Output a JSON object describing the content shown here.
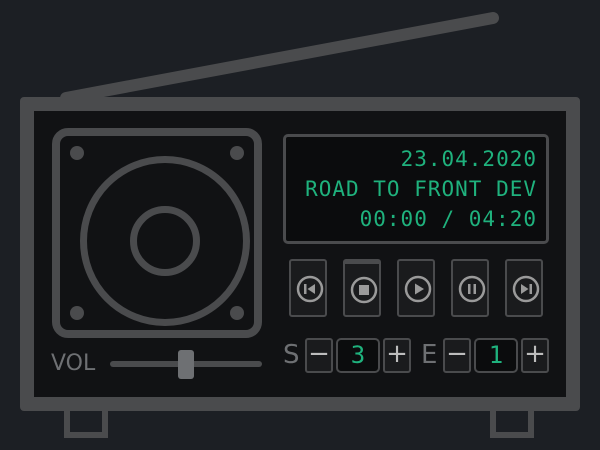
{
  "display": {
    "date": "23.04.2020",
    "track_title": "ROAD TO FRONT DEV",
    "time": "00:00 / 04:20"
  },
  "controls": [
    {
      "name": "previous-button",
      "icon": "skip-previous-icon"
    },
    {
      "name": "stop-button",
      "icon": "stop-icon",
      "active": true
    },
    {
      "name": "play-button",
      "icon": "play-icon"
    },
    {
      "name": "pause-button",
      "icon": "pause-icon"
    },
    {
      "name": "next-button",
      "icon": "skip-next-icon"
    }
  ],
  "volume": {
    "label": "VOL",
    "level": 0.5
  },
  "season": {
    "label": "S",
    "value": "3",
    "minus": "−",
    "plus": "+"
  },
  "episode": {
    "label": "E",
    "value": "1",
    "minus": "−",
    "plus": "+"
  },
  "colors": {
    "frame": "#4a4b4d",
    "lcd_text": "#1fb27d",
    "background": "#1c1f24"
  }
}
